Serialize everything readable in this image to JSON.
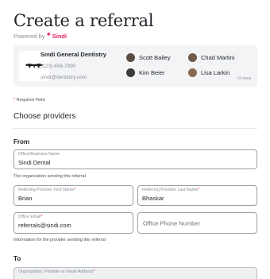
{
  "header": {
    "title": "Create a referral",
    "powered_by": "Powered by",
    "brand": "Sindi"
  },
  "organization": {
    "name": "Sindi General Dentistry",
    "phone": "(123) 456-7890",
    "email": "sindi@dentistry.com"
  },
  "providers": [
    {
      "name": "Scott Bailey",
      "avatar_color": "#5b4a3f"
    },
    {
      "name": "Chad Martini",
      "avatar_color": "#6d5a4b"
    },
    {
      "name": "Kim Beier",
      "avatar_color": "#3d3a38"
    },
    {
      "name": "Lisa Larkin",
      "avatar_color": "#8a6b52"
    }
  ],
  "providers_more": "+3 more",
  "required_note": "Required Field",
  "choose_providers": "Choose providers",
  "from": {
    "heading": "From",
    "office_name": {
      "label": "Office/Business Name",
      "value": "Sindi Dental"
    },
    "office_helper": "The organization sending this referral",
    "first_name": {
      "label": "Referring Provider First Name",
      "value": "Brian"
    },
    "last_name": {
      "label": "Referring Provider Last Name",
      "value": "Bhaskar"
    },
    "office_email": {
      "label": "Office Email",
      "value": "referrals@sindi.com"
    },
    "office_phone": {
      "placeholder": "Office Phone Number"
    },
    "provider_helper": "Information for the provider sending this referral"
  },
  "to": {
    "heading": "To",
    "search": {
      "label": "Organization, Provider or Email Address"
    }
  },
  "colors": {
    "accent": "#e0245e",
    "card_bg": "#f3f4f6",
    "border": "#9aa0a6"
  }
}
